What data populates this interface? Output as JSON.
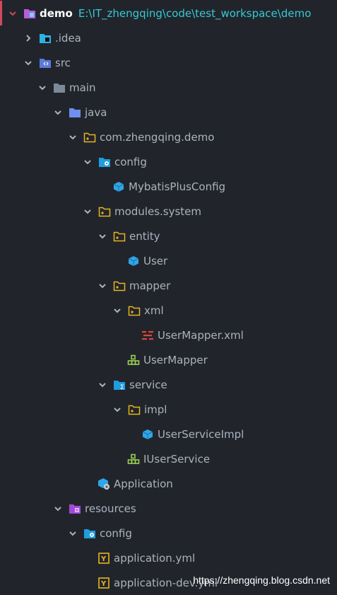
{
  "project": {
    "name": "demo",
    "path": "E:\\IT_zhengqing\\code\\test_workspace\\demo"
  },
  "tree": {
    "idea": ".idea",
    "src": "src",
    "main": "main",
    "java": "java",
    "pkg": "com.zhengqing.demo",
    "config": "config",
    "mybatis": "MybatisPlusConfig",
    "modules": "modules.system",
    "entity": "entity",
    "user": "User",
    "mapper": "mapper",
    "xml": "xml",
    "usermapper_xml": "UserMapper.xml",
    "usermapper": "UserMapper",
    "service": "service",
    "impl": "impl",
    "userserviceimpl": "UserServiceImpl",
    "iuserservice": "IUserService",
    "application": "Application",
    "resources": "resources",
    "res_config": "config",
    "application_yml": "application.yml",
    "application_dev": "application-dev.yml"
  },
  "watermark": "https://zhengqing.blog.csdn.net"
}
